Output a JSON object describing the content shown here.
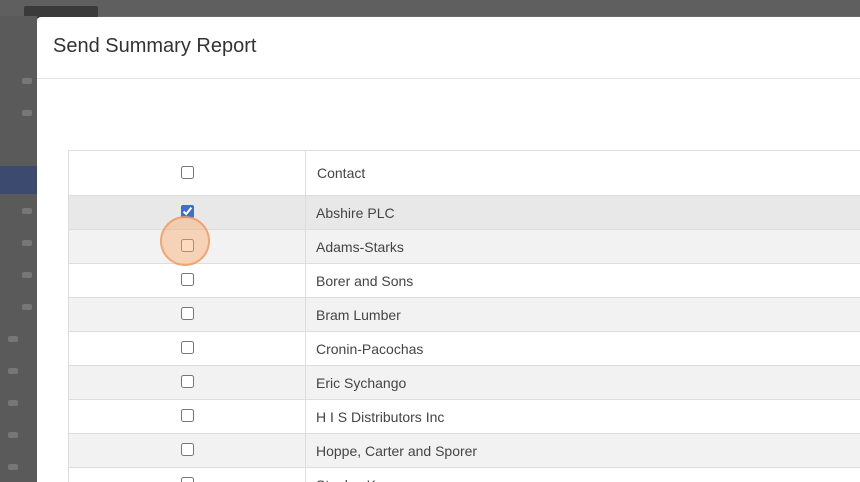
{
  "modal": {
    "title": "Send Summary Report"
  },
  "table": {
    "header": "Contact",
    "rows": [
      {
        "name": "Abshire PLC",
        "checked": true
      },
      {
        "name": "Adams-Starks",
        "checked": false
      },
      {
        "name": "Borer and Sons",
        "checked": false
      },
      {
        "name": "Bram Lumber",
        "checked": false
      },
      {
        "name": "Cronin-Pacochas",
        "checked": false
      },
      {
        "name": "Eric Sychango",
        "checked": false
      },
      {
        "name": "H I S Distributors Inc",
        "checked": false
      },
      {
        "name": "Hoppe, Carter and Sporer",
        "checked": false
      },
      {
        "name": "Stanley K...",
        "checked": false
      }
    ]
  },
  "colors": {
    "accent": "#3b6fd1",
    "cursor_highlight": "#f5a36a",
    "overlay": "#6b6b6b"
  }
}
